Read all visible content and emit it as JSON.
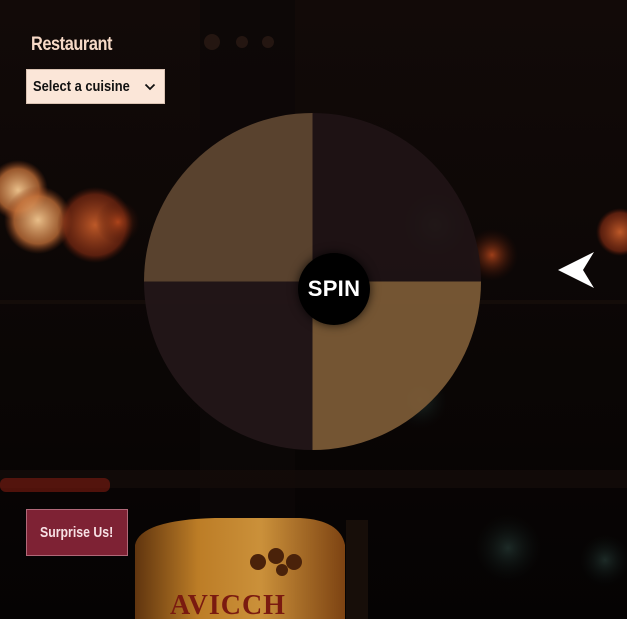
{
  "app": {
    "title": "Restaurant"
  },
  "cuisine_select": {
    "selected": "Select a cuisine",
    "icon": "chevron-down-icon"
  },
  "wheel": {
    "segment_colors": [
      "#5e4630",
      "#1f1416",
      "#231618",
      "#7a5a36"
    ],
    "spin_label": "SPIN"
  },
  "pointer": {
    "icon": "arrow-pointer-icon",
    "color": "#ffffff"
  },
  "surprise": {
    "label": "Surprise Us!"
  },
  "background": {
    "bottle_label_text": "AVICCH"
  },
  "colors": {
    "title": "#f6d9c6",
    "select_bg": "#fbe6d8",
    "surprise_bg": "#7e2234"
  }
}
